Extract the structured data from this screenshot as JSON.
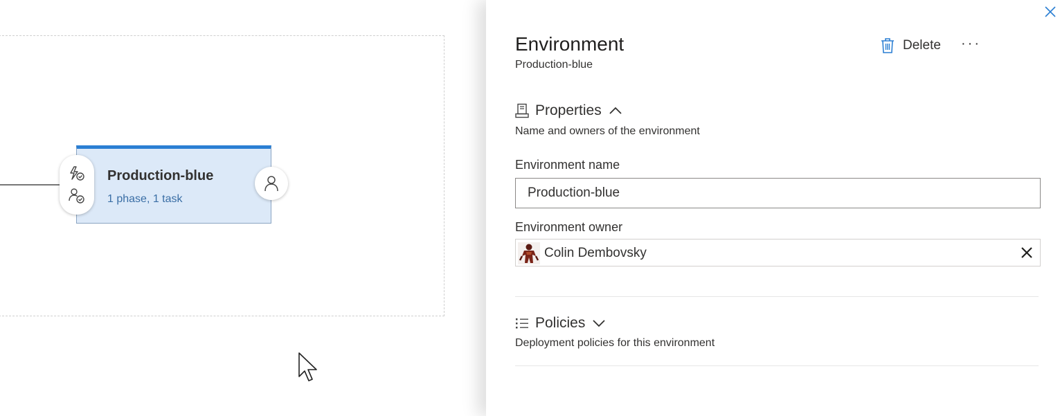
{
  "canvas": {
    "stage": {
      "name": "Production-blue",
      "summary": "1 phase, 1 task"
    }
  },
  "panel": {
    "title": "Environment",
    "subtitle": "Production-blue",
    "delete_label": "Delete",
    "more_label": "···",
    "properties": {
      "title": "Properties",
      "description": "Name and owners of the environment",
      "name_label": "Environment name",
      "name_value": "Production-blue",
      "owner_label": "Environment owner",
      "owner_name": "Colin Dembovsky"
    },
    "policies": {
      "title": "Policies",
      "description": "Deployment policies for this environment"
    }
  },
  "colors": {
    "accent": "#2b7fd3",
    "card_background": "#dce9f8",
    "link_text": "#3a6ea5"
  },
  "icons": {
    "pre_deployment_trigger": "lightning-check-icon",
    "pre_deployment_approvers": "person-check-icon",
    "post_deployment_approvers": "person-icon",
    "close": "close-icon",
    "delete": "trash-icon",
    "properties": "server-icon",
    "policies": "list-icon",
    "collapse": "chevron-up-icon",
    "expand": "chevron-down-icon",
    "remove_owner": "close-icon"
  }
}
